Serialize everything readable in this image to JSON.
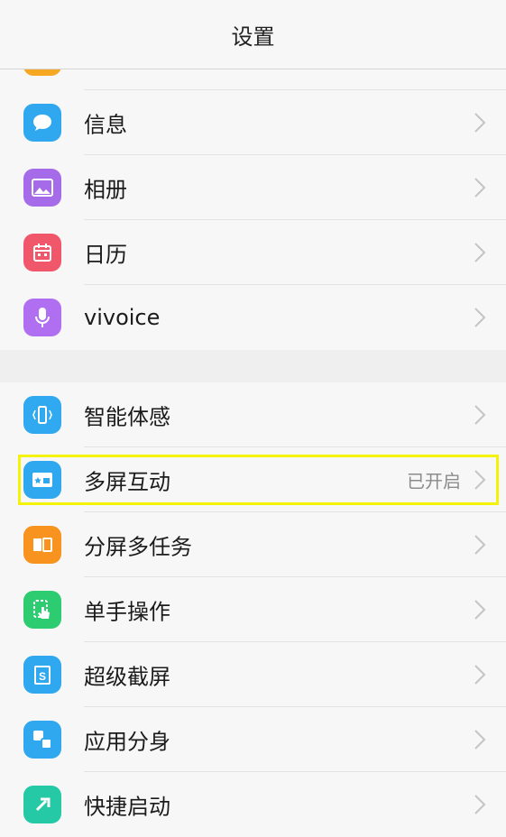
{
  "header": {
    "title": "设置"
  },
  "group1": [
    {
      "name": "messages",
      "label": "信息",
      "icon": "chat-bubble-icon",
      "color": "#2fa8ef"
    },
    {
      "name": "album",
      "label": "相册",
      "icon": "picture-icon",
      "color": "#a66be8"
    },
    {
      "name": "calendar",
      "label": "日历",
      "icon": "calendar-icon",
      "color": "#f1576b"
    },
    {
      "name": "vivoice",
      "label": "vivoice",
      "icon": "microphone-icon",
      "color": "#b06ef0"
    }
  ],
  "group2": [
    {
      "name": "smart-motion",
      "label": "智能体感",
      "icon": "phone-tilt-icon",
      "color": "#31a9f0"
    },
    {
      "name": "multi-screen",
      "label": "多屏互动",
      "status": "已开启",
      "icon": "screen-cast-icon",
      "color": "#2fa8ef"
    },
    {
      "name": "split-screen",
      "label": "分屏多任务",
      "icon": "split-screen-icon",
      "color": "#f7931e"
    },
    {
      "name": "one-hand",
      "label": "单手操作",
      "icon": "hand-tap-icon",
      "color": "#2dcc70"
    },
    {
      "name": "super-screenshot",
      "label": "超级截屏",
      "icon": "screenshot-icon",
      "color": "#2fa8ef"
    },
    {
      "name": "app-clone",
      "label": "应用分身",
      "icon": "app-clone-icon",
      "color": "#2fa8ef"
    },
    {
      "name": "quick-launch",
      "label": "快捷启动",
      "icon": "quick-launch-icon",
      "color": "#25c9a5"
    }
  ],
  "colors": {
    "highlight": "#f4f205",
    "partial_icon": "#f7a823"
  }
}
